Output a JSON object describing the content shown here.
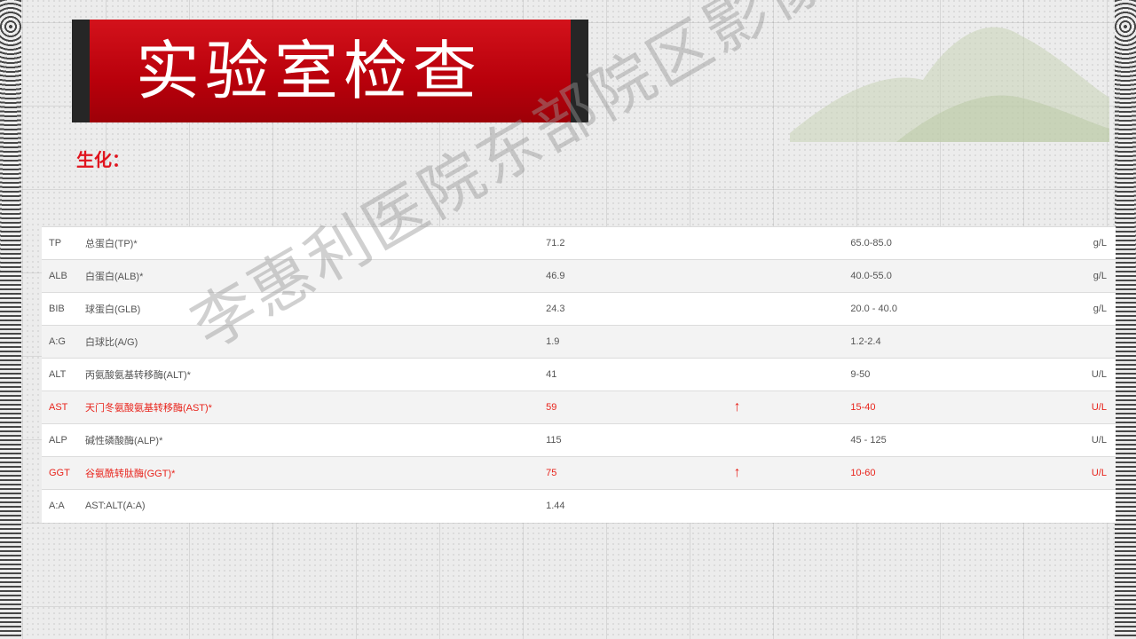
{
  "slide": {
    "title": "实验室检查",
    "subtitle": "生化：",
    "watermark": "李惠利医院东部院区影像科"
  },
  "lab_table": {
    "rows": [
      {
        "code": "TP",
        "name": "总蛋白(TP)*",
        "value": "71.2",
        "flag": "",
        "range": "65.0-85.0",
        "unit": "g/L"
      },
      {
        "code": "ALB",
        "name": "白蛋白(ALB)*",
        "value": "46.9",
        "flag": "",
        "range": "40.0-55.0",
        "unit": "g/L"
      },
      {
        "code": "BIB",
        "name": "球蛋白(GLB)",
        "value": "24.3",
        "flag": "",
        "range": "20.0 - 40.0",
        "unit": "g/L"
      },
      {
        "code": "A:G",
        "name": "白球比(A/G)",
        "value": "1.9",
        "flag": "",
        "range": "1.2-2.4",
        "unit": ""
      },
      {
        "code": "ALT",
        "name": "丙氨酸氨基转移酶(ALT)*",
        "value": "41",
        "flag": "",
        "range": "9-50",
        "unit": "U/L"
      },
      {
        "code": "AST",
        "name": "天门冬氨酸氨基转移酶(AST)*",
        "value": "59",
        "flag": "↑",
        "range": "15-40",
        "unit": "U/L",
        "high": true
      },
      {
        "code": "ALP",
        "name": "碱性磷酸酶(ALP)*",
        "value": "115",
        "flag": "",
        "range": "45 - 125",
        "unit": "U/L"
      },
      {
        "code": "GGT",
        "name": "谷氨酰转肽酶(GGT)*",
        "value": "75",
        "flag": "↑",
        "range": "10-60",
        "unit": "U/L",
        "high": true
      },
      {
        "code": "A:A",
        "name": "AST:ALT(A:A)",
        "value": "1.44",
        "flag": "",
        "range": "",
        "unit": ""
      }
    ]
  },
  "colors": {
    "banner_red": "#c0000c",
    "banner_edge": "#262626",
    "abnormal_text": "#e8241c"
  }
}
